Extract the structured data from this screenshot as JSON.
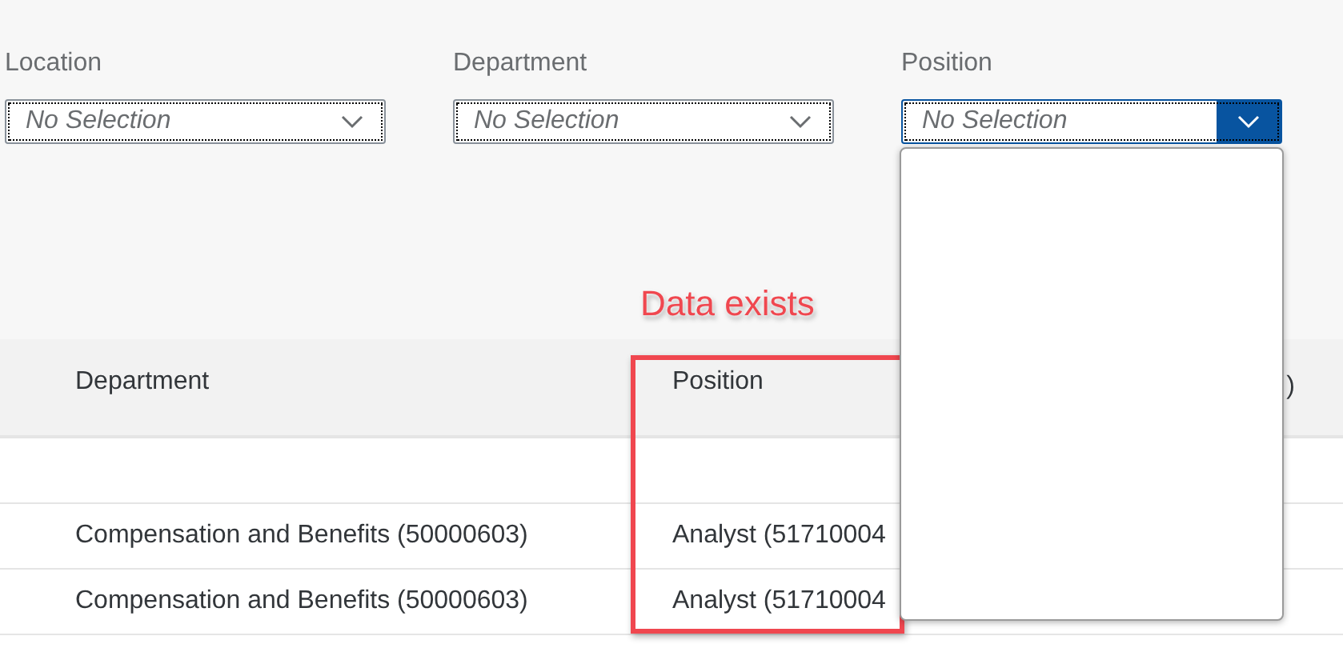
{
  "filters": [
    {
      "label": "Location",
      "placeholder": "No Selection",
      "expanded": false
    },
    {
      "label": "Department",
      "placeholder": "No Selection",
      "expanded": false
    },
    {
      "label": "Position",
      "placeholder": "No Selection",
      "expanded": true
    }
  ],
  "annotation": {
    "text": "Data exists"
  },
  "table": {
    "columns": [
      "Department",
      "Position",
      ")"
    ],
    "rows": [
      {
        "cells": [
          "",
          ""
        ]
      },
      {
        "cells": [
          "Compensation and Benefits (50000603)",
          "Analyst (51710004"
        ]
      },
      {
        "cells": [
          "Compensation and Benefits (50000603)",
          "Analyst (51710004"
        ]
      }
    ]
  }
}
